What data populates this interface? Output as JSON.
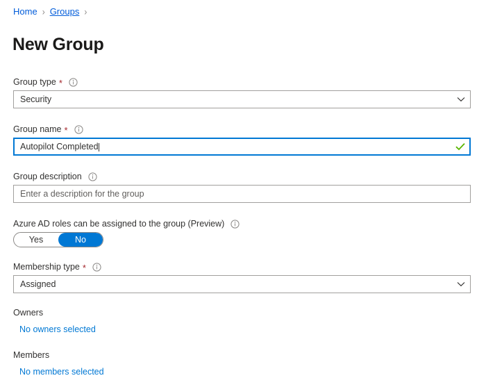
{
  "breadcrumb": {
    "items": [
      {
        "label": "Home",
        "active": false
      },
      {
        "label": "Groups",
        "active": true
      }
    ],
    "separator": "›"
  },
  "page": {
    "title": "New Group"
  },
  "form": {
    "group_type": {
      "label": "Group type",
      "required_marker": "*",
      "value": "Security",
      "info_tooltip": "Group type"
    },
    "group_name": {
      "label": "Group name",
      "required_marker": "*",
      "value": "Autopilot Completed",
      "validation": "valid"
    },
    "group_description": {
      "label": "Group description",
      "value": "",
      "placeholder": "Enter a description for the group"
    },
    "azure_ad_roles": {
      "label": "Azure AD roles can be assigned to the group (Preview)",
      "options": [
        {
          "label": "Yes",
          "selected": false
        },
        {
          "label": "No",
          "selected": true
        }
      ],
      "selected": "No"
    },
    "membership_type": {
      "label": "Membership type",
      "required_marker": "*",
      "value": "Assigned"
    },
    "owners": {
      "label": "Owners",
      "link_text": "No owners selected"
    },
    "members": {
      "label": "Members",
      "link_text": "No members selected"
    }
  },
  "colors": {
    "accent": "#0078d4",
    "link": "#015cda",
    "required": "#a4262c",
    "valid_check": "#5ab500",
    "border": "#a19f9d",
    "text": "#323130"
  }
}
